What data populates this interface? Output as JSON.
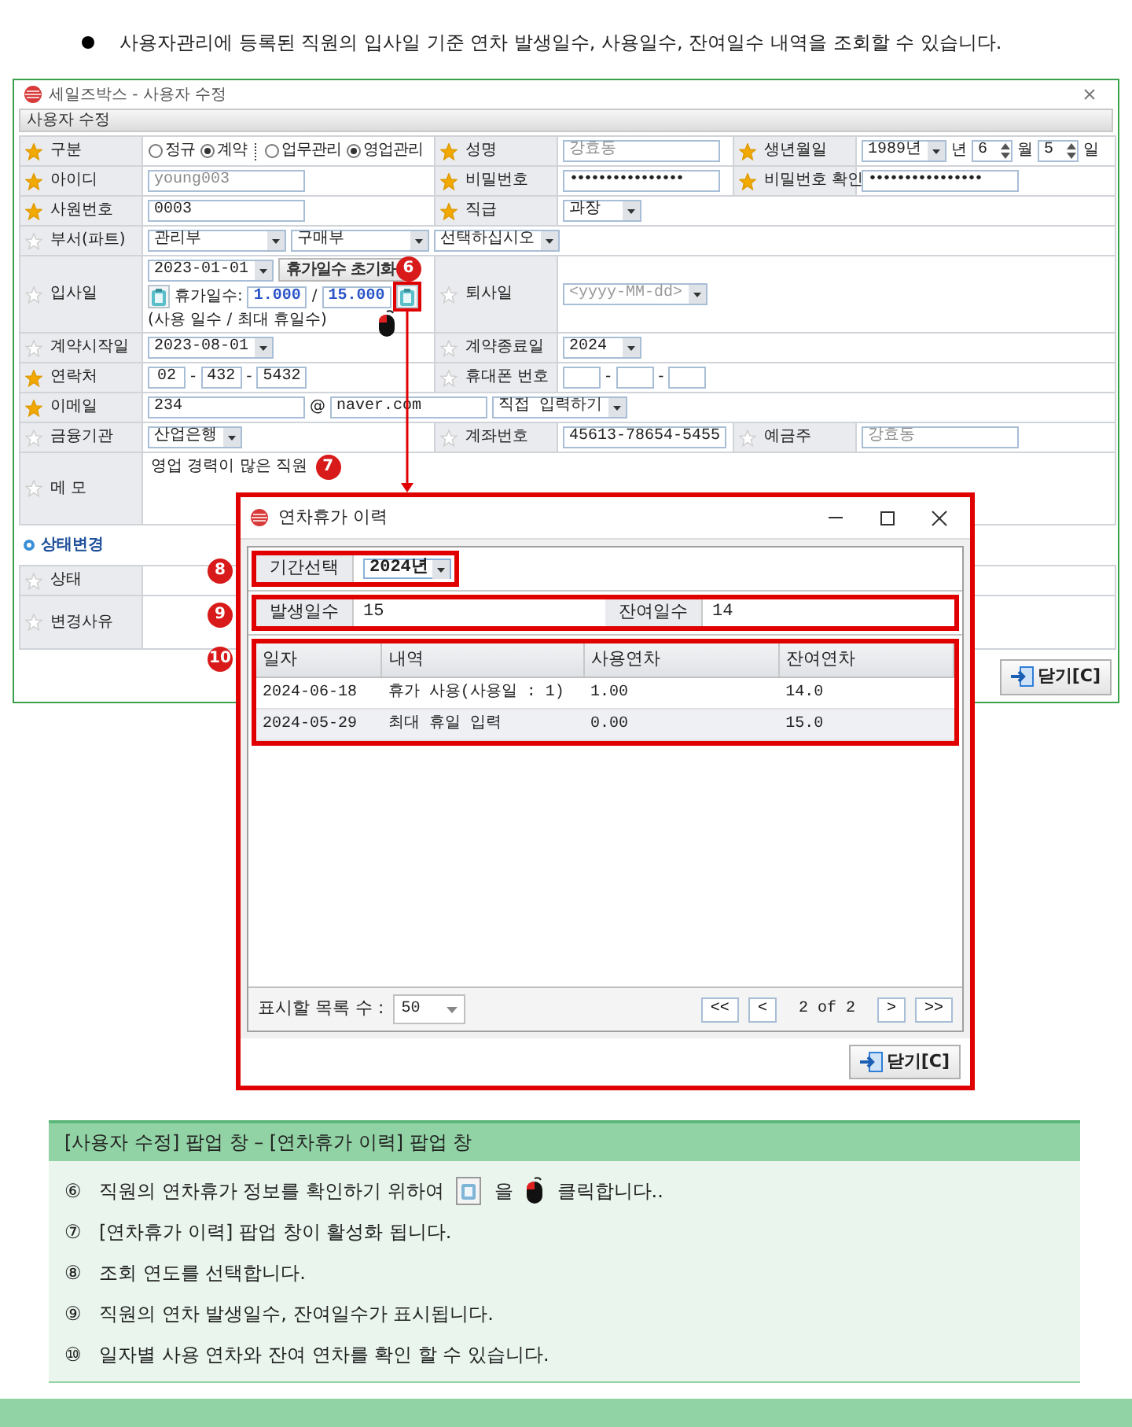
{
  "intro": {
    "text": "사용자관리에 등록된 직원의 입사일 기준 연차 발생일수, 사용일수, 잔여일수 내역을 조회할 수 있습니다."
  },
  "form_window": {
    "title": "세일즈박스 - 사용자 수정",
    "section_title": "사용자 수정",
    "rows": [
      {
        "cells": [
          {
            "kind": "label",
            "text": "구분",
            "required": true
          },
          {
            "kind": "content",
            "controls": [
              {
                "kind": "radio",
                "label": "정규",
                "selected": false
              },
              {
                "kind": "radio",
                "label": "계약",
                "selected": true
              },
              {
                "kind": "divider"
              },
              {
                "kind": "radio",
                "label": "업무관리",
                "selected": false
              },
              {
                "kind": "radio",
                "label": "영업관리",
                "selected": true
              }
            ]
          },
          {
            "kind": "label",
            "text": "성명",
            "required": true
          },
          {
            "kind": "content",
            "controls": [
              {
                "kind": "field",
                "value": "강효동",
                "disabled": true
              }
            ]
          },
          {
            "kind": "label",
            "text": "생년월일",
            "required": true
          },
          {
            "kind": "content",
            "controls": [
              {
                "kind": "select",
                "value": "1989년"
              },
              {
                "kind": "text",
                "text": "년"
              },
              {
                "kind": "spin",
                "value": "6"
              },
              {
                "kind": "text",
                "text": "월"
              },
              {
                "kind": "spin",
                "value": "5"
              },
              {
                "kind": "text",
                "text": "일"
              }
            ]
          }
        ]
      },
      {
        "cells": [
          {
            "kind": "label",
            "text": "아이디",
            "required": true
          },
          {
            "kind": "content",
            "controls": [
              {
                "kind": "field",
                "value": "young003",
                "disabled": true
              }
            ]
          },
          {
            "kind": "label",
            "text": "비밀번호",
            "required": true
          },
          {
            "kind": "content",
            "controls": [
              {
                "kind": "password",
                "value": "••••••••••••••••"
              }
            ]
          },
          {
            "kind": "label",
            "text": "비밀번호 확인",
            "required": true
          },
          {
            "kind": "content",
            "controls": [
              {
                "kind": "password",
                "value": "••••••••••••••••"
              }
            ]
          }
        ]
      },
      {
        "cells": [
          {
            "kind": "label",
            "text": "사원번호",
            "required": true
          },
          {
            "kind": "content",
            "controls": [
              {
                "kind": "field",
                "value": "0003",
                "disabled": false
              }
            ]
          },
          {
            "kind": "label",
            "text": "직급",
            "required": true
          },
          {
            "kind": "content",
            "controls": [
              {
                "kind": "select",
                "value": "과장"
              }
            ]
          }
        ]
      },
      {
        "cells": [
          {
            "kind": "label",
            "text": "부서(파트)",
            "required": false
          },
          {
            "kind": "content",
            "controls": [
              {
                "kind": "select",
                "value": "관리부"
              },
              {
                "kind": "select",
                "value": "구매부"
              },
              {
                "kind": "select",
                "value": "선택하십시오"
              }
            ]
          }
        ]
      },
      {
        "cells": [
          {
            "kind": "label",
            "text": "입사일",
            "required": false
          },
          {
            "kind": "content",
            "controls": [
              {
                "kind": "select",
                "value": "2023-01-01"
              },
              {
                "kind": "button",
                "label": "휴가일수 초기화"
              },
              {
                "kind": "tool",
                "highlighted": false
              },
              {
                "kind": "text",
                "text": "휴가일수:"
              },
              {
                "kind": "number",
                "value": "1.000"
              },
              {
                "kind": "text",
                "text": "/"
              },
              {
                "kind": "number",
                "value": "15.000"
              },
              {
                "kind": "tool",
                "highlighted": true
              },
              {
                "kind": "text",
                "text": "(사용 일수 / 최대 휴일수)"
              }
            ]
          },
          {
            "kind": "label",
            "text": "퇴사일",
            "required": false
          },
          {
            "kind": "content",
            "controls": [
              {
                "kind": "select",
                "placeholder": "<yyyy-MM-dd>"
              }
            ]
          }
        ]
      },
      {
        "cells": [
          {
            "kind": "label",
            "text": "계약시작일",
            "required": false
          },
          {
            "kind": "content",
            "controls": [
              {
                "kind": "select",
                "value": "2023-08-01"
              }
            ]
          },
          {
            "kind": "label",
            "text": "계약종료일",
            "required": false
          },
          {
            "kind": "content",
            "controls": [
              {
                "kind": "select",
                "value": "2024"
              }
            ]
          }
        ]
      },
      {
        "cells": [
          {
            "kind": "label",
            "text": "연락처",
            "required": true
          },
          {
            "kind": "content",
            "controls": [
              {
                "kind": "box",
                "value": "02"
              },
              {
                "kind": "text",
                "text": "-"
              },
              {
                "kind": "box",
                "value": "432"
              },
              {
                "kind": "text",
                "text": "-"
              },
              {
                "kind": "box",
                "value": "5432"
              }
            ]
          },
          {
            "kind": "label",
            "text": "휴대폰 번호",
            "required": false
          },
          {
            "kind": "content",
            "controls": [
              {
                "kind": "box"
              },
              {
                "kind": "text",
                "text": "-"
              },
              {
                "kind": "box"
              },
              {
                "kind": "text",
                "text": "-"
              },
              {
                "kind": "box"
              }
            ]
          }
        ]
      },
      {
        "cells": [
          {
            "kind": "label",
            "text": "이메일",
            "required": true
          },
          {
            "kind": "content",
            "controls": [
              {
                "kind": "field",
                "value": "234",
                "disabled": false
              },
              {
                "kind": "text",
                "text": "@"
              },
              {
                "kind": "field",
                "value": "naver.com",
                "disabled": false
              },
              {
                "kind": "select",
                "value": "직접 입력하기"
              }
            ]
          }
        ]
      },
      {
        "cells": [
          {
            "kind": "label",
            "text": "금융기관",
            "required": false
          },
          {
            "kind": "content",
            "controls": [
              {
                "kind": "select",
                "value": "산업은행"
              }
            ]
          },
          {
            "kind": "label",
            "text": "계좌번호",
            "required": false
          },
          {
            "kind": "content",
            "controls": [
              {
                "kind": "field",
                "value": "45613-78654-5455",
                "disabled": false
              }
            ]
          },
          {
            "kind": "label",
            "text": "예금주",
            "required": false
          },
          {
            "kind": "content",
            "controls": [
              {
                "kind": "field",
                "value": "강효동",
                "disabled": true
              }
            ]
          }
        ]
      },
      {
        "cells": [
          {
            "kind": "label",
            "text": "메 모",
            "required": false
          },
          {
            "kind": "content",
            "controls": [
              {
                "kind": "memo",
                "text": "영업 경력이 많은 직원"
              }
            ]
          }
        ]
      }
    ],
    "status_section": {
      "title": "상태변경",
      "rows": [
        {
          "label": "상태",
          "required": false
        },
        {
          "label": "변경사유",
          "required": false
        }
      ]
    },
    "close_button": "닫기[C]"
  },
  "callouts": [
    {
      "number": "6"
    },
    {
      "number": "7"
    },
    {
      "number": "8"
    },
    {
      "number": "9"
    },
    {
      "number": "10"
    }
  ],
  "popup": {
    "title": "연차휴가 이력",
    "period": {
      "label": "기간선택",
      "value": "2024년"
    },
    "summary": [
      {
        "label": "발생일수",
        "value": "15"
      },
      {
        "label": "잔여일수",
        "value": "14"
      }
    ],
    "table": {
      "columns": [
        "일자",
        "내역",
        "사용연차",
        "잔여연차"
      ],
      "rows": [
        [
          "2024-06-18",
          "휴가 사용(사용일 : 1)",
          "1.00",
          "14.0"
        ],
        [
          "2024-05-29",
          "최대 휴일 입력",
          "0.00",
          "15.0"
        ]
      ]
    },
    "pager": {
      "page_size_label": "표시할 목록 수 :",
      "page_size": "50",
      "prev_buttons": [
        "<<",
        "<"
      ],
      "page_info": "2 of 2",
      "next_buttons": [
        ">",
        ">>"
      ]
    },
    "close_button": "닫기[C]"
  },
  "instructions": {
    "title": "[사용자 수정] 팝업 창 – [연차휴가 이력] 팝업 창",
    "items": [
      {
        "number": "⑥",
        "parts": [
          {
            "kind": "text",
            "text": "직원의 연차휴가 정보를 확인하기 위하여"
          },
          {
            "kind": "tool"
          },
          {
            "kind": "text",
            "text": "을"
          },
          {
            "kind": "mouse"
          },
          {
            "kind": "text",
            "text": "클릭합니다.."
          }
        ]
      },
      {
        "number": "⑦",
        "parts": [
          {
            "kind": "text",
            "text": "[연차휴가 이력]  팝업 창이 활성화 됩니다."
          }
        ]
      },
      {
        "number": "⑧",
        "parts": [
          {
            "kind": "text",
            "text": "조회 연도를 선택합니다."
          }
        ]
      },
      {
        "number": "⑨",
        "parts": [
          {
            "kind": "text",
            "text": "직원의 연차 발생일수, 잔여일수가 표시됩니다."
          }
        ]
      },
      {
        "number": "⑩",
        "parts": [
          {
            "kind": "text",
            "text": "일자별 사용 연차와 잔여 연차를 확인 할 수 있습니다."
          }
        ]
      }
    ]
  }
}
